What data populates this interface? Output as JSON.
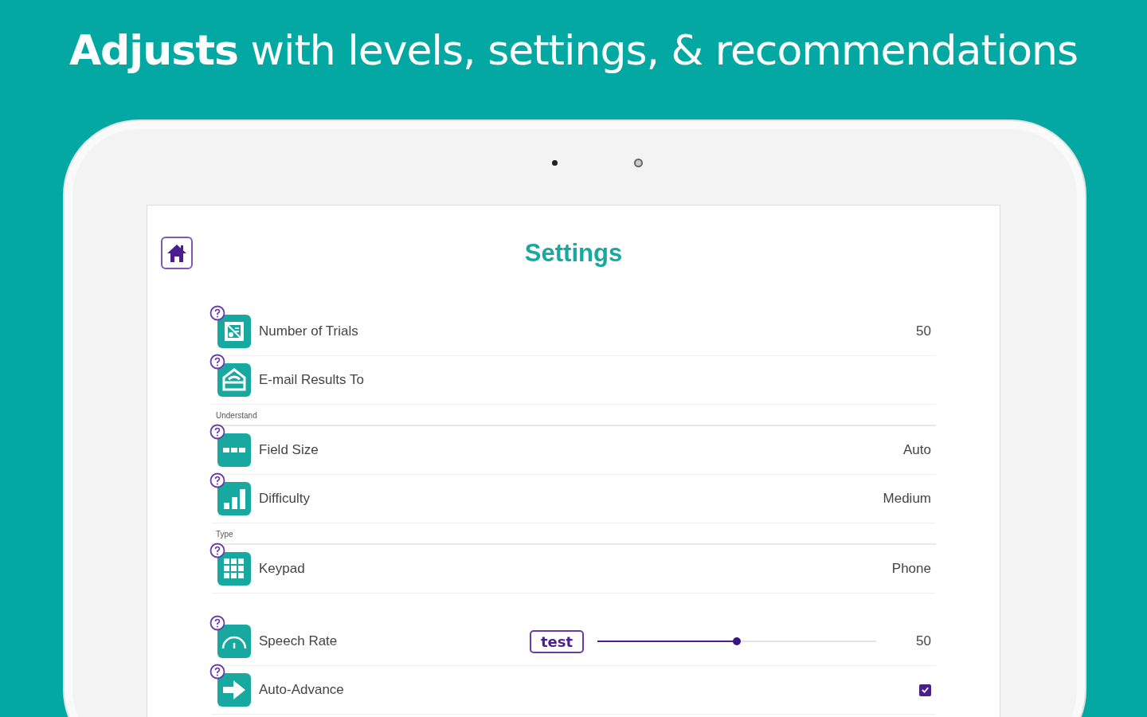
{
  "headline": "**Adjusts** with levels, settings, & recommendations",
  "screen": {
    "title": "Settings"
  },
  "items": [
    {
      "kind": "value",
      "label": "Number of Trials",
      "value": "50"
    },
    {
      "kind": "value",
      "label": "E-mail Results To"
    },
    {
      "kind": "section",
      "label": "Understand"
    },
    {
      "kind": "value",
      "label": "Field Size",
      "value": "Auto"
    },
    {
      "kind": "value",
      "label": "Difficulty",
      "value": "Medium"
    },
    {
      "kind": "section",
      "label": "Type"
    },
    {
      "kind": "value",
      "label": "Keypad",
      "value": "Phone"
    },
    {
      "kind": "slider",
      "label": "Speech Rate",
      "button": "test",
      "level": 0.5,
      "value": "50"
    },
    {
      "kind": "checkbox",
      "label": "Auto-Advance",
      "checked": true
    }
  ]
}
